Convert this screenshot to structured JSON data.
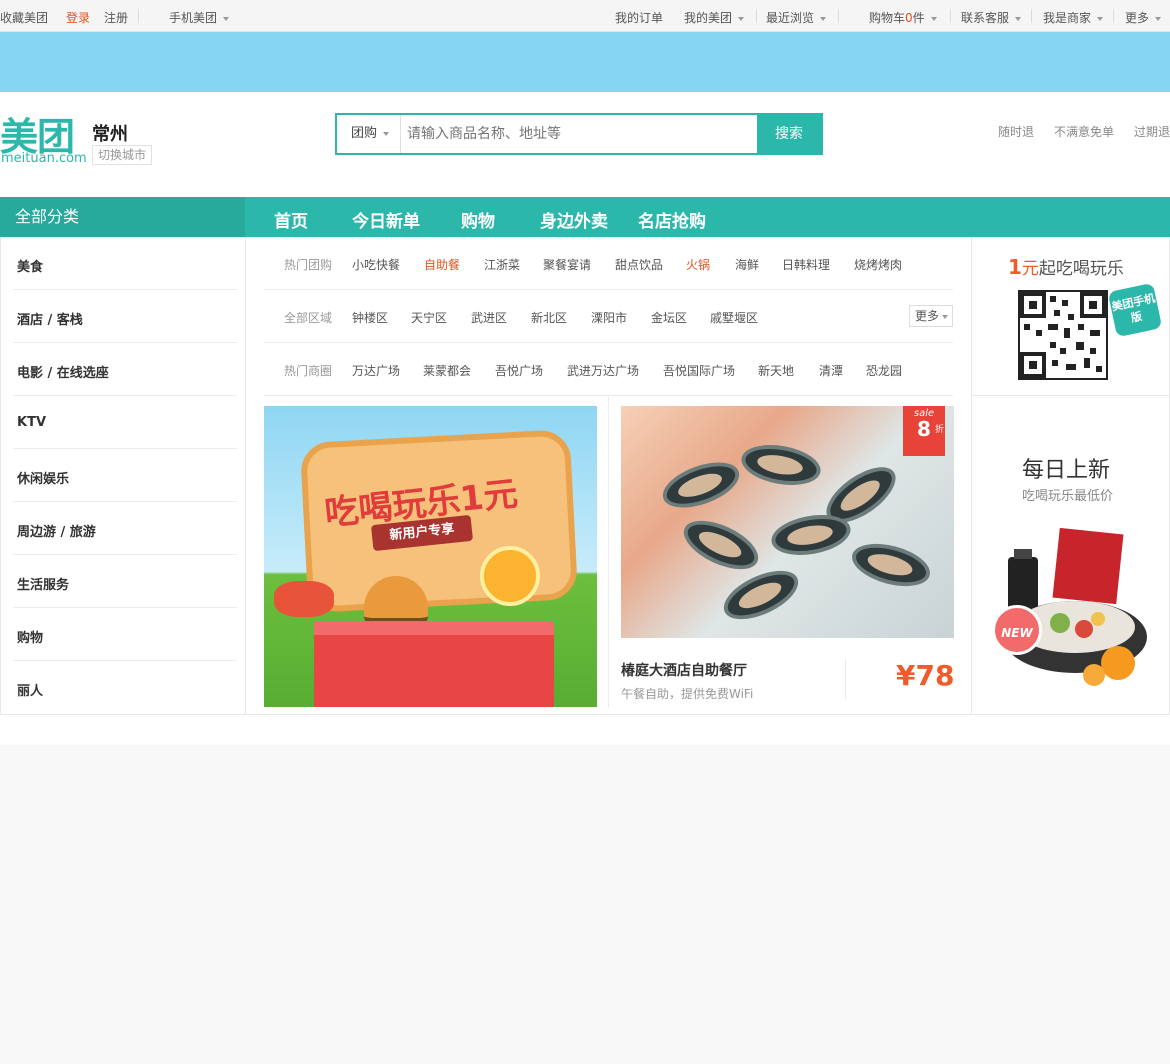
{
  "topbar": {
    "bookmark": "收藏美团",
    "login": "登录",
    "register": "注册",
    "mobile": "手机美团",
    "orders": "我的订单",
    "my_meituan": "我的美团",
    "recent": "最近浏览",
    "cart_prefix": "购物车",
    "cart_count": "0",
    "cart_suffix": "件",
    "service": "联系客服",
    "merchant": "我是商家",
    "more": "更多"
  },
  "header": {
    "logo_cn": "美团",
    "logo_en": "meituan.com",
    "city": "常州",
    "switch_city": "切换城市",
    "search_category": "团购",
    "search_placeholder": "请输入商品名称、地址等",
    "search_button": "搜索",
    "guarantees": [
      "随时退",
      "不满意免单",
      "过期退"
    ]
  },
  "nav": {
    "all_categories": "全部分类",
    "items": [
      "首页",
      "今日新单",
      "购物",
      "身边外卖",
      "名店抢购"
    ]
  },
  "sidebar": {
    "items": [
      "美食",
      "酒店 / 客栈",
      "电影 / 在线选座",
      "KTV",
      "休闲娱乐",
      "周边游 / 旅游",
      "生活服务",
      "购物",
      "丽人"
    ]
  },
  "filters": {
    "hot_deals": {
      "label": "热门团购",
      "items": [
        "小吃快餐",
        "自助餐",
        "江浙菜",
        "聚餐宴请",
        "甜点饮品",
        "火锅",
        "海鲜",
        "日韩料理",
        "烧烤烤肉"
      ]
    },
    "districts": {
      "label": "全部区域",
      "items": [
        "钟楼区",
        "天宁区",
        "武进区",
        "新北区",
        "溧阳市",
        "金坛区",
        "戚墅堰区"
      ],
      "more": "更多"
    },
    "hot_malls": {
      "label": "热门商圈",
      "items": [
        "万达广场",
        "莱蒙都会",
        "吾悦广场",
        "武进万达广场",
        "吾悦国际广场",
        "新天地",
        "清潭",
        "恐龙园"
      ]
    }
  },
  "promo": {
    "title": "吃喝玩乐1元",
    "subtitle": "新用户专享"
  },
  "deal": {
    "sale_label": "sale",
    "discount": "8",
    "discount_unit": "折",
    "name": "椿庭大酒店自助餐厅",
    "desc": "午餐自助，提供免费WiFi",
    "price": "¥78"
  },
  "right_panel": {
    "one_yuan_num": "1",
    "one_yuan_unit": "元",
    "one_yuan_text": "起吃喝玩乐",
    "qr_tag": "美团手机版",
    "daily_title": "每日上新",
    "daily_sub": "吃喝玩乐最低价",
    "new_badge": "NEW"
  },
  "colors": {
    "brand": "#2bb8aa",
    "accent": "#e5511d",
    "price": "#ef5b2b",
    "banner": "#85d6f3"
  }
}
